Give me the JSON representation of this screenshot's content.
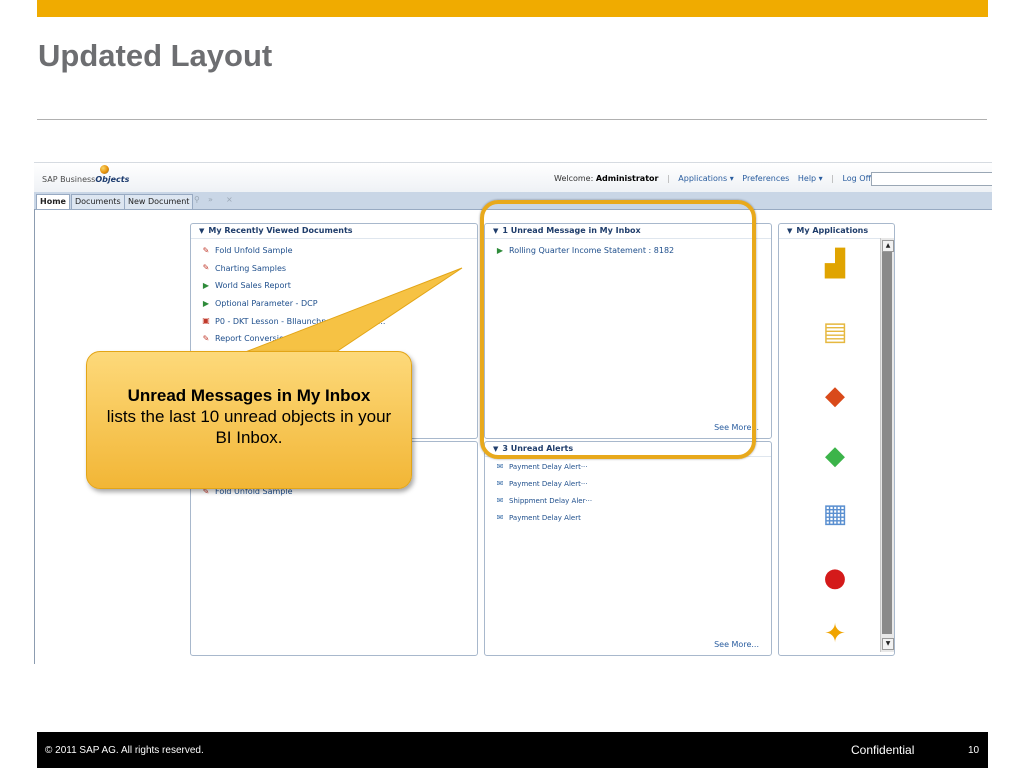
{
  "slide": {
    "title": "Updated Layout",
    "footer": {
      "copyright": "© 2011 SAP AG. All rights reserved.",
      "confidential": "Confidential",
      "page": "10"
    }
  },
  "app": {
    "logo_text": "SAP Business",
    "logo_bold": "Objects",
    "header": {
      "welcome_label": "Welcome:",
      "user": "Administrator",
      "applications": "Applications ▾",
      "preferences": "Preferences",
      "help": "Help ▾",
      "logoff": "Log Off"
    },
    "tabs": [
      "Home",
      "Documents",
      "New Document"
    ],
    "recent": {
      "title": "My Recently Viewed Documents",
      "items": [
        "Fold Unfold Sample",
        "Charting Samples",
        "World Sales Report",
        "Optional Parameter - DCP",
        "P0 - DKT Lesson - BIlaunchpad ... d Positi...",
        "Report Conversion T... Report"
      ]
    },
    "inbox": {
      "title": "1 Unread Message in My Inbox",
      "items": [
        "Rolling Quarter Income Statement : 8182"
      ],
      "see_more": "See More..."
    },
    "favorites": {
      "items": [
        "Fold Unfold Sample"
      ]
    },
    "alerts": {
      "title": "3 Unread Alerts",
      "items": [
        "Payment Delay Alert···",
        "Payment Delay Alert···",
        "Shippment Delay Aler···",
        "Payment Delay Alert"
      ],
      "see_more": "See More..."
    },
    "applications": {
      "title": "My Applications"
    }
  },
  "callout": {
    "title": "Unread Messages in My Inbox",
    "body": "lists the last 10 unread objects in your BI Inbox."
  },
  "colors": {
    "accent": "#f0ab00",
    "callout": "#f7c64a",
    "highlight": "#e8a91c",
    "link": "#1f4f8c"
  }
}
